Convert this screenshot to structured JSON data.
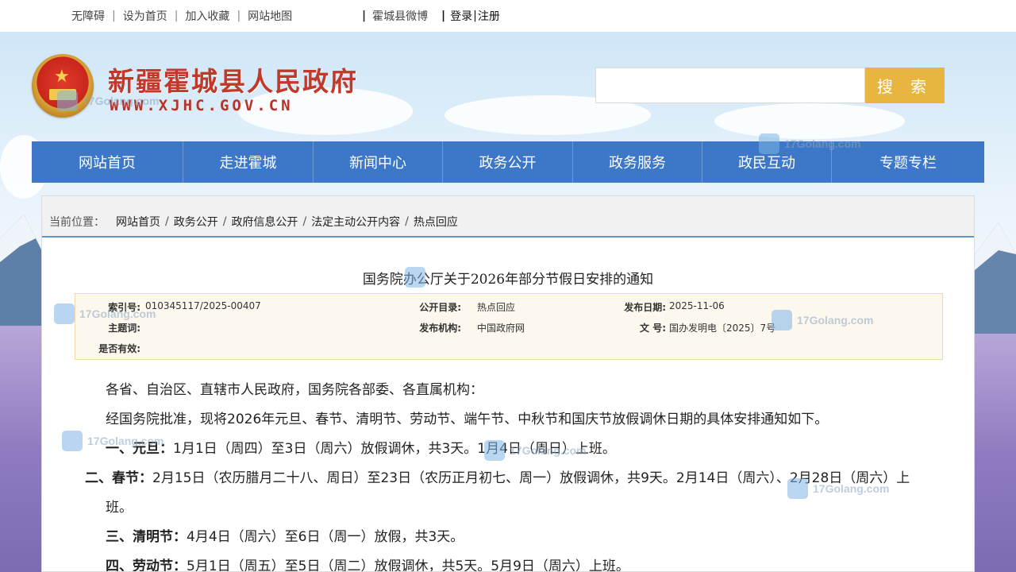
{
  "topbar": {
    "links": [
      "无障碍",
      "设为首页",
      "加入收藏",
      "网站地图"
    ],
    "weibo": "霍城县微博",
    "login": "登录",
    "register": "注册"
  },
  "header": {
    "site_name": "新疆霍城县人民政府",
    "domain": "WWW.XJHC.GOV.CN",
    "search_button": "搜 索",
    "search_placeholder": ""
  },
  "nav": [
    "网站首页",
    "走进霍城",
    "新闻中心",
    "政务公开",
    "政务服务",
    "政民互动",
    "专题专栏"
  ],
  "breadcrumb": {
    "label": "当前位置：",
    "items": [
      "网站首页",
      "政务公开",
      "政府信息公开",
      "法定主动公开内容",
      "热点回应"
    ]
  },
  "document": {
    "title": "国务院办公厅关于2026年部分节假日安排的通知",
    "meta": {
      "index_label": "索引号:",
      "index_value": "010345117/2025-00407",
      "catalog_label": "公开目录:",
      "catalog_value": "热点回应",
      "date_label": "发布日期:",
      "date_value": "2025-11-06",
      "subject_label": "主题词:",
      "subject_value": "",
      "publisher_label": "发布机构:",
      "publisher_value": "中国政府网",
      "docno_label": "文 号:",
      "docno_value": "国办发明电〔2025〕7号",
      "valid_label": "是否有效:",
      "valid_value": ""
    },
    "paragraphs": {
      "p1": "各省、自治区、直辖市人民政府，国务院各部委、各直属机构：",
      "p2": "经国务院批准，现将2026年元旦、春节、清明节、劳动节、端午节、中秋节和国庆节放假调休日期的具体安排通知如下。",
      "p3_head": "一、元旦：",
      "p3_body": "1月1日（周四）至3日（周六）放假调休，共3天。1月4日（周日）上班。",
      "p4_head": "二、春节：",
      "p4_body": "2月15日（农历腊月二十八、周日）至23日（农历正月初七、周一）放假调休，共9天。2月14日（周六）、2月28日（周六）上班。",
      "p5_head": "三、清明节：",
      "p5_body": "4月4日（周六）至6日（周一）放假，共3天。",
      "p6_head": "四、劳动节：",
      "p6_body": "5月1日（周五）至5日（周二）放假调休，共5天。5月9日（周六）上班。"
    }
  },
  "watermark": "17Golang.com"
}
